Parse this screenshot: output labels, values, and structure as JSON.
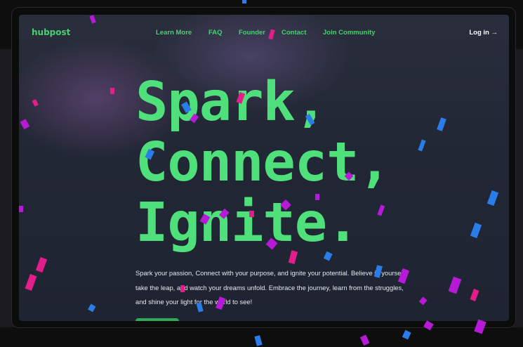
{
  "nav": {
    "logo": "hubpost",
    "links": [
      "Learn More",
      "FAQ",
      "Founder",
      "Contact",
      "Join Community"
    ],
    "login": "Log in →"
  },
  "hero": {
    "line1": "Spark,",
    "line2": "Connect,",
    "line3": "Ignite.",
    "description": "Spark your passion, Connect with your purpose, and ignite your potential. Believe in yourself, take the leap, and watch your dreams unfold. Embrace the journey, learn from the struggles, and shine your light for the world to see!"
  },
  "colors": {
    "accent": "#47d16f",
    "headline": "#4fe07c",
    "background": "#222735",
    "confetti": [
      "#e21e8a",
      "#2a7de8",
      "#b61ad6"
    ]
  }
}
